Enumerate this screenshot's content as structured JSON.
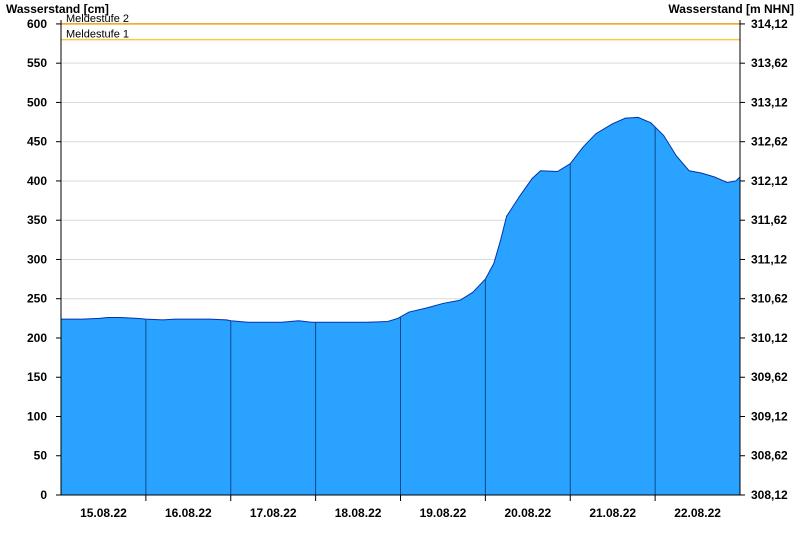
{
  "chart_data": {
    "type": "area",
    "y_axis_left_title": "Wasserstand [cm]",
    "y_axis_right_title": "Wasserstand [m NHN]",
    "y_left_ticks": [
      0,
      50,
      100,
      150,
      200,
      250,
      300,
      350,
      400,
      450,
      500,
      550,
      600
    ],
    "y_right_ticks": [
      "308,12",
      "308,62",
      "309,12",
      "309,62",
      "310,12",
      "310,62",
      "311,12",
      "311,62",
      "312,12",
      "312,62",
      "313,12",
      "313,62",
      "314,12"
    ],
    "ylim": [
      0,
      605
    ],
    "x_day_labels": [
      "15.08.22",
      "16.08.22",
      "17.08.22",
      "18.08.22",
      "19.08.22",
      "20.08.22",
      "21.08.22",
      "22.08.22"
    ],
    "xlim_days": [
      0,
      8
    ],
    "day_boundaries": [
      1,
      2,
      3,
      4,
      5,
      6,
      7
    ],
    "thresholds": [
      {
        "label": "Meldestufe 2",
        "value": 600,
        "color": "#e8a317"
      },
      {
        "label": "Meldestufe 1",
        "value": 580,
        "color": "#f2c94c"
      }
    ],
    "series": [
      {
        "fill_color": "#29a3ff",
        "edge_color": "#0033aa",
        "points": [
          [
            0.0,
            224
          ],
          [
            0.25,
            224
          ],
          [
            0.45,
            225
          ],
          [
            0.55,
            226
          ],
          [
            0.7,
            226
          ],
          [
            0.9,
            225
          ],
          [
            1.0,
            224
          ],
          [
            1.2,
            223
          ],
          [
            1.35,
            224
          ],
          [
            1.5,
            224
          ],
          [
            1.75,
            224
          ],
          [
            1.95,
            223
          ],
          [
            2.0,
            222
          ],
          [
            2.2,
            220
          ],
          [
            2.4,
            220
          ],
          [
            2.6,
            220
          ],
          [
            2.8,
            222
          ],
          [
            2.95,
            220
          ],
          [
            3.0,
            220
          ],
          [
            3.3,
            220
          ],
          [
            3.6,
            220
          ],
          [
            3.85,
            221
          ],
          [
            3.97,
            225
          ],
          [
            4.1,
            233
          ],
          [
            4.3,
            238
          ],
          [
            4.5,
            244
          ],
          [
            4.7,
            248
          ],
          [
            4.85,
            258
          ],
          [
            5.0,
            275
          ],
          [
            5.1,
            295
          ],
          [
            5.18,
            325
          ],
          [
            5.25,
            355
          ],
          [
            5.4,
            380
          ],
          [
            5.55,
            403
          ],
          [
            5.65,
            413
          ],
          [
            5.85,
            412
          ],
          [
            6.0,
            422
          ],
          [
            6.15,
            443
          ],
          [
            6.3,
            460
          ],
          [
            6.5,
            473
          ],
          [
            6.65,
            480
          ],
          [
            6.8,
            481
          ],
          [
            6.95,
            474
          ],
          [
            7.1,
            458
          ],
          [
            7.25,
            432
          ],
          [
            7.4,
            413
          ],
          [
            7.55,
            410
          ],
          [
            7.7,
            405
          ],
          [
            7.85,
            398
          ],
          [
            7.95,
            400
          ],
          [
            8.0,
            405
          ]
        ]
      }
    ]
  }
}
